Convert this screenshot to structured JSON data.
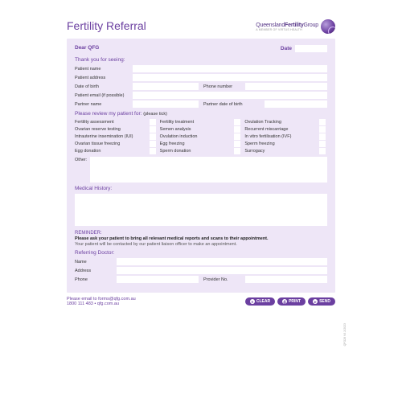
{
  "header": {
    "title": "Fertility Referral",
    "brand_light": "Queensland",
    "brand_bold": "Fertility",
    "brand_end": "Group",
    "brand_sub": "A MEMBER OF VIRTUS HEALTH"
  },
  "dear": "Dear QFG",
  "date_label": "Date",
  "sections": {
    "thank": "Thank you for seeing:",
    "review": "Please review my patient for:",
    "review_note": "(please tick)",
    "medhist": "Medical History:",
    "refdoc": "Referring Doctor:"
  },
  "fields": {
    "patient_name": "Patient name",
    "patient_address": "Patient address",
    "dob": "Date of birth",
    "phone": "Phone number",
    "email": "Patient email (if possible)",
    "partner_name": "Partner name",
    "partner_dob": "Partner date of birth",
    "other": "Other:",
    "name": "Name",
    "address": "Address",
    "phone2": "Phone",
    "provider": "Provider No."
  },
  "review_items": [
    "Fertility assessment",
    "Fertility treatment",
    "Ovulation Tracking",
    "Ovarian reserve testing",
    "Semen analysis",
    "Recurrent miscarriage",
    "Intrauterine insemination (IUI)",
    "Ovulation induction",
    "In vitro fertilisation (IVF)",
    "Ovarian tissue freezing",
    "Egg freezing",
    "Sperm freezing",
    "Egg donation",
    "Sperm donation",
    "Surrogacy"
  ],
  "reminder": {
    "head": "REMINDER:",
    "main": "Please ask your patient to bring all relevant medical reports and scans to their appointment.",
    "sub": "Your patient will be contacted by our patient liaison officer to make an appointment."
  },
  "footer": {
    "line1_pre": "Please email to ",
    "email": "forms@qfg.com.au",
    "line2": "1800 111 483  •  qfg.com.au"
  },
  "buttons": {
    "clear": "CLEAR",
    "print": "PRINT",
    "send": "SEND"
  },
  "code": "QFG28 V4 2/2023"
}
